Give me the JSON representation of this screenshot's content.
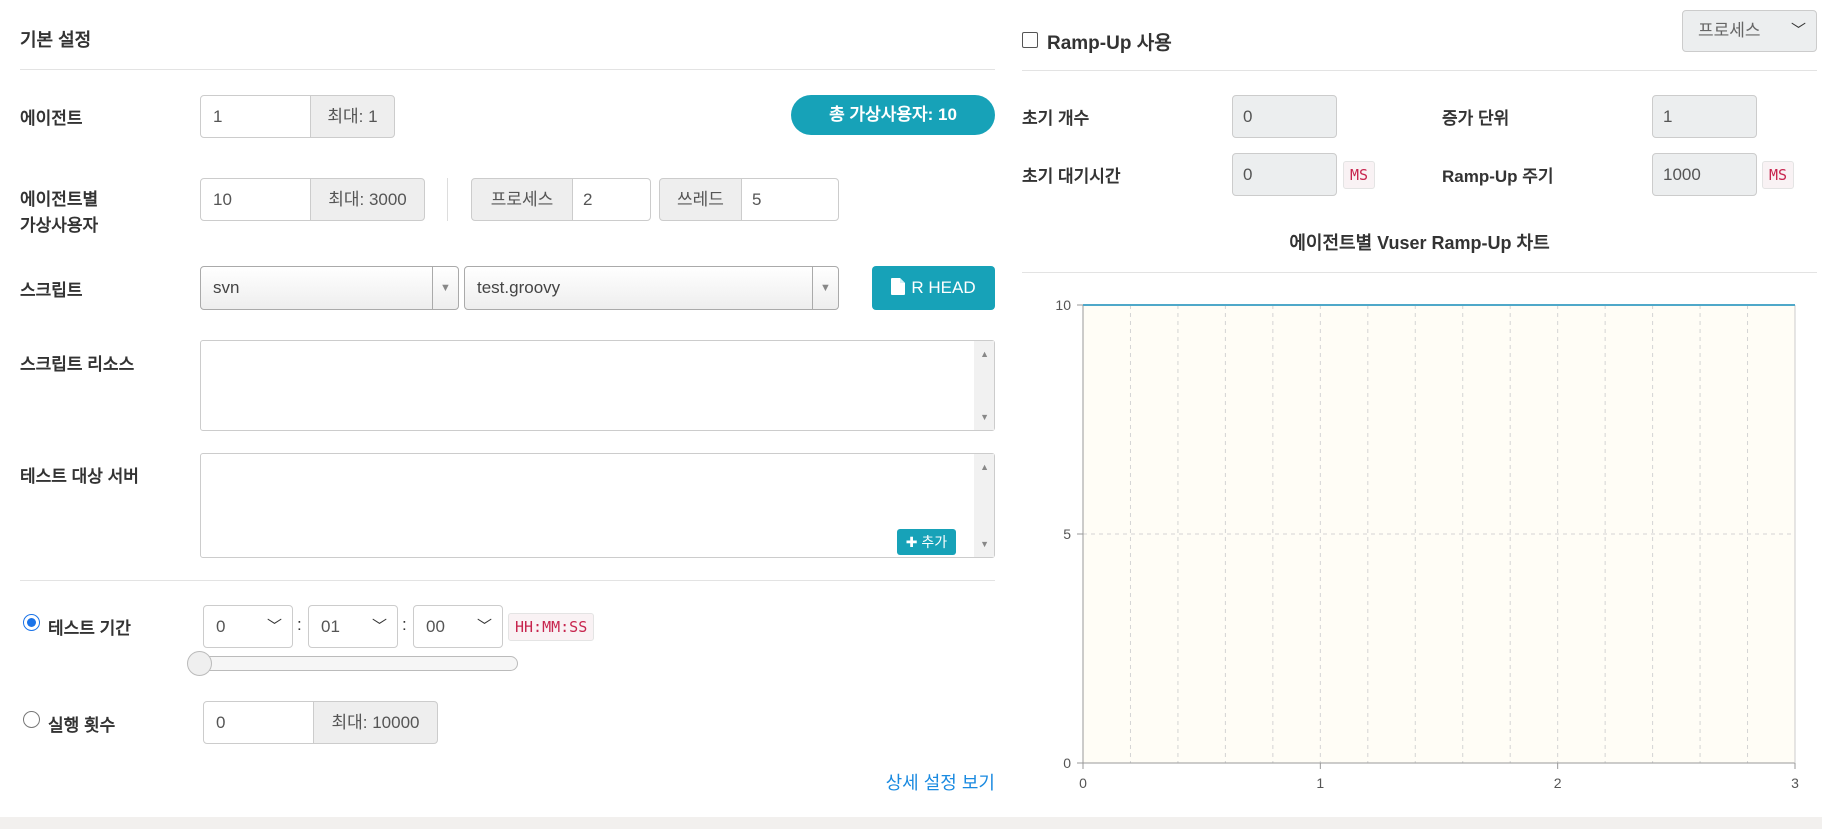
{
  "basic": {
    "title": "기본 설정",
    "agent_label": "에이전트",
    "agent_value": "1",
    "agent_max": "최대: 1",
    "total_vuser_badge": "총 가상사용자: 10",
    "vuser_label_line1": "에이전트별",
    "vuser_label_line2": "가상사용자",
    "vuser_value": "10",
    "vuser_max": "최대: 3000",
    "process_label": "프로세스",
    "process_value": "2",
    "thread_label": "쓰레드",
    "thread_value": "5",
    "script_label": "스크립트",
    "script_repo": "svn",
    "script_file": "test.groovy",
    "rhead_button": "R HEAD",
    "script_resource_label": "스크립트 리소스",
    "target_server_label": "테스트 대상 서버",
    "add_button": "추가",
    "duration_label": "테스트 기간",
    "duration_hours": "0",
    "duration_minutes": "01",
    "duration_seconds": "00",
    "duration_sep": ":",
    "duration_unit": "HH:MM:SS",
    "duration_slider_fraction": 0,
    "runcount_label": "실행 횟수",
    "runcount_value": "0",
    "runcount_max": "최대: 10000",
    "detail_link": "상세 설정 보기"
  },
  "rampup": {
    "enable_label": "Ramp-Up 사용",
    "enabled": false,
    "type_select": "프로세스",
    "init_count_label": "초기 개수",
    "init_count_value": "0",
    "step_label": "증가 단위",
    "step_value": "1",
    "init_sleep_label": "초기 대기시간",
    "init_sleep_value": "0",
    "init_sleep_unit": "MS",
    "interval_label": "Ramp-Up 주기",
    "interval_value": "1000",
    "interval_unit": "MS"
  },
  "chart_data": {
    "type": "line",
    "title": "에이전트별 Vuser Ramp-Up 차트",
    "xlabel": "",
    "ylabel": "",
    "xlim": [
      0,
      3
    ],
    "ylim": [
      0,
      10
    ],
    "x_ticks": [
      "0",
      "1",
      "2",
      "3"
    ],
    "y_ticks": [
      "0",
      "5",
      "10"
    ],
    "series": [
      {
        "x": [
          0,
          3
        ],
        "y": [
          10,
          10
        ]
      }
    ],
    "grid": true,
    "line_color": "#4fa8c9",
    "plot_background": "#fffdf6"
  },
  "colors": {
    "accent": "#17a2b8",
    "link": "#1a8ae0",
    "unit_text": "#c7254e"
  }
}
